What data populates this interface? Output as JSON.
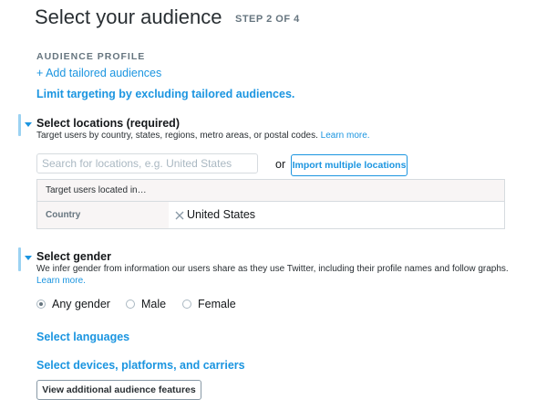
{
  "header": {
    "title": "Select your audience",
    "step": "STEP 2 OF 4"
  },
  "audience_profile": {
    "label": "AUDIENCE PROFILE",
    "add_link": "+ Add tailored audiences",
    "limit_link": "Limit targeting by excluding tailored audiences."
  },
  "locations": {
    "heading": "Select locations (required)",
    "description": "Target users by country, states, regions, metro areas, or postal codes.",
    "learn_more": "Learn more.",
    "search_placeholder": "Search for locations, e.g. United States",
    "search_value": "",
    "or_text": "or",
    "import_button": "Import multiple locations",
    "table": {
      "header": "Target users located in…",
      "rows": [
        {
          "label": "Country",
          "value": "United States",
          "remove_icon": "close-icon"
        }
      ]
    }
  },
  "gender": {
    "heading": "Select gender",
    "description": "We infer gender from information our users share as they use Twitter, including their profile names and follow graphs.",
    "learn_more": "Learn more.",
    "options": [
      {
        "label": "Any gender",
        "checked": true
      },
      {
        "label": "Male",
        "checked": false
      },
      {
        "label": "Female",
        "checked": false
      }
    ]
  },
  "links": {
    "languages": "Select languages",
    "devices": "Select devices, platforms, and carriers"
  },
  "additional_button": "View additional audience features",
  "colors": {
    "accent": "#1b95e0",
    "section_bar": "#9bd2f2",
    "muted_text": "#66757f"
  }
}
